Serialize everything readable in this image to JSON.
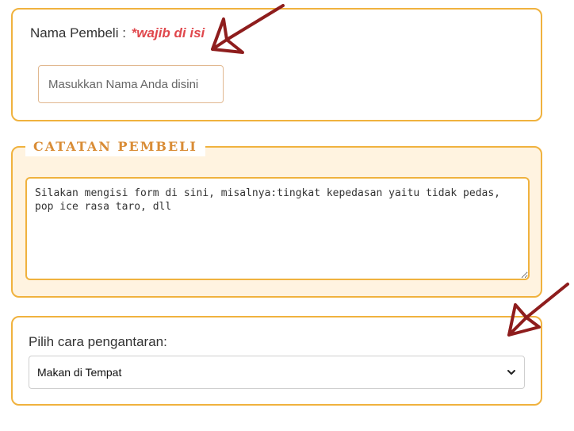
{
  "name_section": {
    "label": "Nama Pembeli : ",
    "required": "*wajib di isi",
    "placeholder": "Masukkan Nama Anda disini"
  },
  "notes_section": {
    "legend": "CATATAN PEMBELI",
    "text": "Silakan mengisi form di sini, misalnya:tingkat kepedasan yaitu tidak pedas, pop ice rasa taro, dll"
  },
  "delivery_section": {
    "label": "Pilih cara pengantaran:",
    "selected": "Makan di Tempat"
  },
  "icons": {
    "arrow": "arrow-icon",
    "chevron": "chevron-down-icon"
  },
  "colors": {
    "border": "#f0b23e",
    "legend": "#d98c35",
    "required": "#e0474c",
    "arrow": "#8e1d1d",
    "notes_background": "#fff3e0"
  }
}
